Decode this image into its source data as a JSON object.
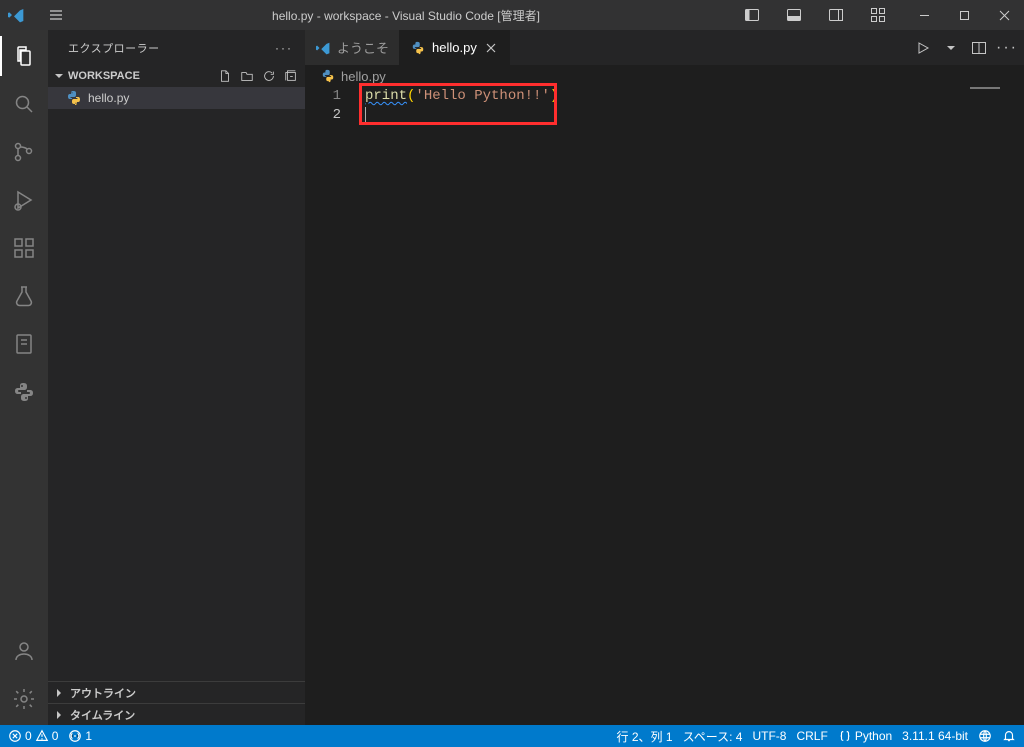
{
  "titlebar": {
    "title": "hello.py - workspace - Visual Studio Code [管理者]"
  },
  "sidebar": {
    "title": "エクスプローラー",
    "workspace_name": "WORKSPACE",
    "files": [
      {
        "name": "hello.py"
      }
    ],
    "sections": {
      "outline": "アウトライン",
      "timeline": "タイムライン"
    }
  },
  "tabs": [
    {
      "label": "ようこそ",
      "active": false
    },
    {
      "label": "hello.py",
      "active": true
    }
  ],
  "breadcrumb": {
    "file": "hello.py"
  },
  "editor": {
    "lines": {
      "l1": {
        "num": "1",
        "fn": "print",
        "par_open": "(",
        "str": "'Hello Python!!'",
        "par_close": ")"
      },
      "l2": {
        "num": "2"
      }
    }
  },
  "status": {
    "errors": "0",
    "warnings": "0",
    "ports": "1",
    "cursor": "行 2、列 1",
    "indent": "スペース: 4",
    "encoding": "UTF-8",
    "eol": "CRLF",
    "lang": "Python",
    "interpreter": "3.11.1 64-bit"
  }
}
